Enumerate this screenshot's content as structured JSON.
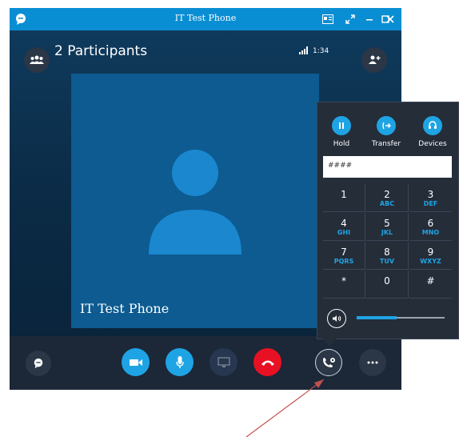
{
  "window": {
    "title": "IT Test Phone"
  },
  "header": {
    "participants": "2 Participants",
    "duration": "1:34"
  },
  "video": {
    "caller_name": "IT Test Phone"
  },
  "dialpad": {
    "actions": [
      {
        "label": "Hold",
        "icon": "pause-icon"
      },
      {
        "label": "Transfer",
        "icon": "transfer-icon"
      },
      {
        "label": "Devices",
        "icon": "headset-icon"
      }
    ],
    "input_value": "####",
    "keys": [
      {
        "digit": "1",
        "letters": ""
      },
      {
        "digit": "2",
        "letters": "ABC"
      },
      {
        "digit": "3",
        "letters": "DEF"
      },
      {
        "digit": "4",
        "letters": "GHI"
      },
      {
        "digit": "5",
        "letters": "JKL"
      },
      {
        "digit": "6",
        "letters": "MNO"
      },
      {
        "digit": "7",
        "letters": "PQRS"
      },
      {
        "digit": "8",
        "letters": "TUV"
      },
      {
        "digit": "9",
        "letters": "WXYZ"
      },
      {
        "digit": "*",
        "letters": ""
      },
      {
        "digit": "0",
        "letters": ""
      },
      {
        "digit": "#",
        "letters": ""
      }
    ],
    "volume_level": 0.45
  },
  "colors": {
    "accent": "#1ea4e4",
    "titlebar": "#0a8ed3",
    "hangup": "#e81123",
    "annotation_arrow": "#c0504d"
  }
}
